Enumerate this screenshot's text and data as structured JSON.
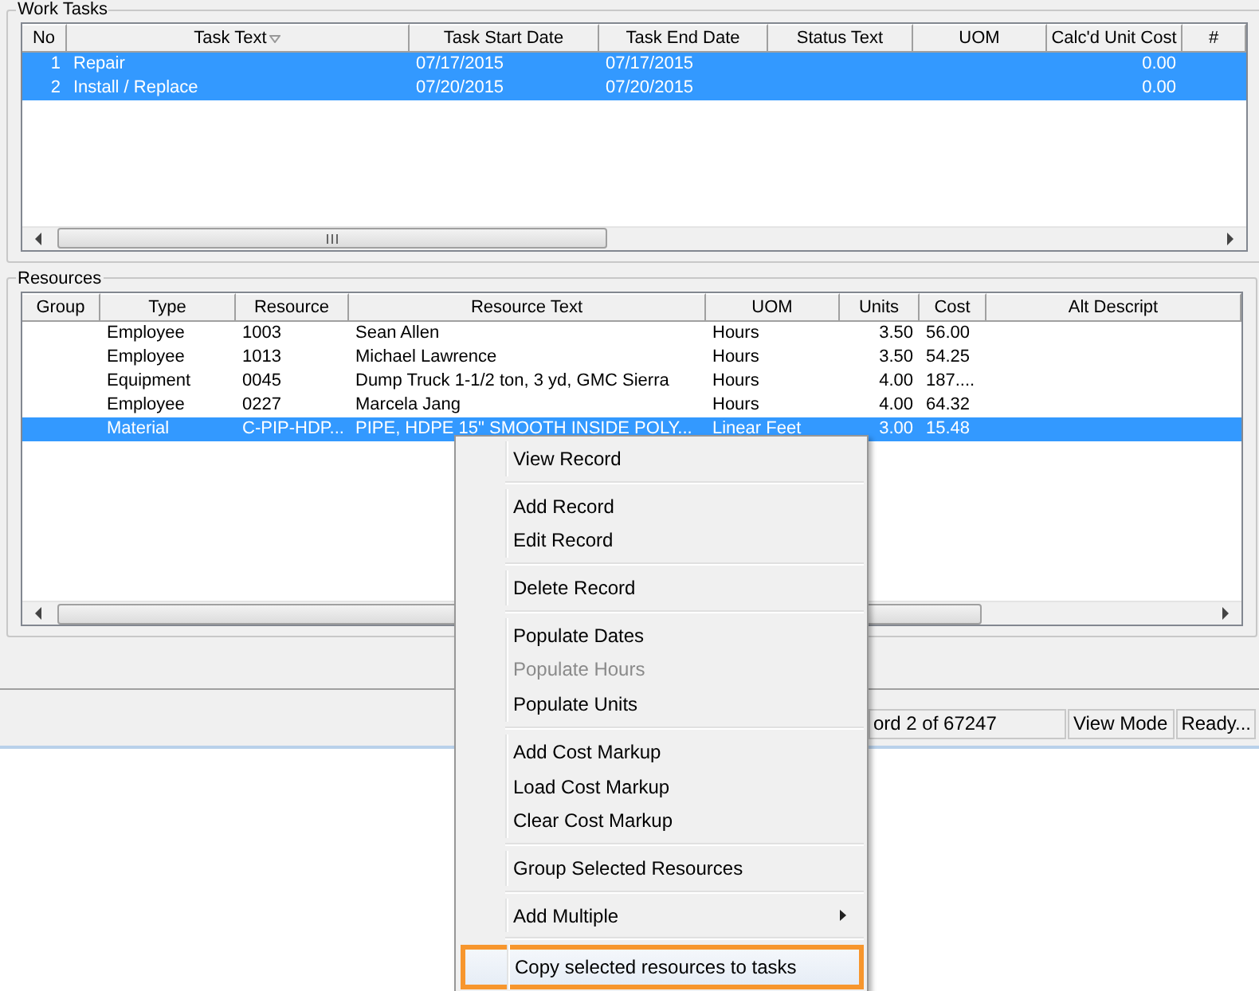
{
  "work_tasks": {
    "title": "Work Tasks",
    "columns": [
      {
        "label": "No",
        "sorted": false
      },
      {
        "label": "Task Text",
        "sorted": true
      },
      {
        "label": "Task Start Date",
        "sorted": false
      },
      {
        "label": "Task End Date",
        "sorted": false
      },
      {
        "label": "Status Text",
        "sorted": false
      },
      {
        "label": "UOM",
        "sorted": false
      },
      {
        "label": "Calc'd Unit Cost",
        "sorted": false
      },
      {
        "label": "#",
        "sorted": false
      }
    ],
    "rows": [
      {
        "selected": true,
        "cells": [
          "1",
          "Repair",
          "07/17/2015",
          "07/17/2015",
          "",
          "",
          "0.00",
          ""
        ]
      },
      {
        "selected": true,
        "cells": [
          "2",
          "Install / Replace",
          "07/20/2015",
          "07/20/2015",
          "",
          "",
          "0.00",
          ""
        ]
      }
    ]
  },
  "resources": {
    "title": "Resources",
    "columns": [
      "Group",
      "Type",
      "Resource",
      "Resource Text",
      "UOM",
      "Units",
      "Cost",
      "Alt Descript"
    ],
    "rows": [
      {
        "selected": false,
        "cells": [
          "",
          "Employee",
          "1003",
          "Sean Allen",
          "Hours",
          "3.50",
          "56.00",
          ""
        ]
      },
      {
        "selected": false,
        "cells": [
          "",
          "Employee",
          "1013",
          "Michael Lawrence",
          "Hours",
          "3.50",
          "54.25",
          ""
        ]
      },
      {
        "selected": false,
        "cells": [
          "",
          "Equipment",
          "0045",
          "Dump Truck 1-1/2 ton, 3 yd, GMC Sierra",
          "Hours",
          "4.00",
          "187....",
          ""
        ]
      },
      {
        "selected": false,
        "cells": [
          "",
          "Employee",
          "0227",
          "Marcela Jang",
          "Hours",
          "4.00",
          "64.32",
          ""
        ]
      },
      {
        "selected": true,
        "cells": [
          "",
          "Material",
          "C-PIP-HDP...",
          "PIPE, HDPE 15\" SMOOTH INSIDE POLY...",
          "Linear Feet",
          "3.00",
          "15.48",
          ""
        ]
      }
    ]
  },
  "status_bar": [
    "ord 2 of 67247",
    "View Mode",
    "Ready..."
  ],
  "context_menu": [
    {
      "kind": "item",
      "label": "View Record",
      "disabled": false,
      "highlighted": false
    },
    {
      "kind": "separator"
    },
    {
      "kind": "item",
      "label": "Add Record",
      "disabled": false,
      "highlighted": false
    },
    {
      "kind": "item",
      "label": "Edit Record",
      "disabled": false,
      "highlighted": false
    },
    {
      "kind": "separator"
    },
    {
      "kind": "item",
      "label": "Delete Record",
      "disabled": false,
      "highlighted": false
    },
    {
      "kind": "separator"
    },
    {
      "kind": "item",
      "label": "Populate Dates",
      "disabled": false,
      "highlighted": false
    },
    {
      "kind": "item",
      "label": "Populate Hours",
      "disabled": true,
      "highlighted": false
    },
    {
      "kind": "item",
      "label": "Populate Units",
      "disabled": false,
      "highlighted": false
    },
    {
      "kind": "separator"
    },
    {
      "kind": "item",
      "label": "Add Cost Markup",
      "disabled": false,
      "highlighted": false
    },
    {
      "kind": "item",
      "label": "Load Cost Markup",
      "disabled": false,
      "highlighted": false
    },
    {
      "kind": "item",
      "label": "Clear Cost Markup",
      "disabled": false,
      "highlighted": false
    },
    {
      "kind": "separator"
    },
    {
      "kind": "item",
      "label": "Group Selected Resources",
      "disabled": false,
      "highlighted": false
    },
    {
      "kind": "separator"
    },
    {
      "kind": "submenu",
      "label": "Add Multiple",
      "disabled": false,
      "highlighted": false
    },
    {
      "kind": "separator"
    },
    {
      "kind": "item",
      "label": "Copy selected resources to tasks",
      "disabled": false,
      "highlighted": true
    }
  ]
}
